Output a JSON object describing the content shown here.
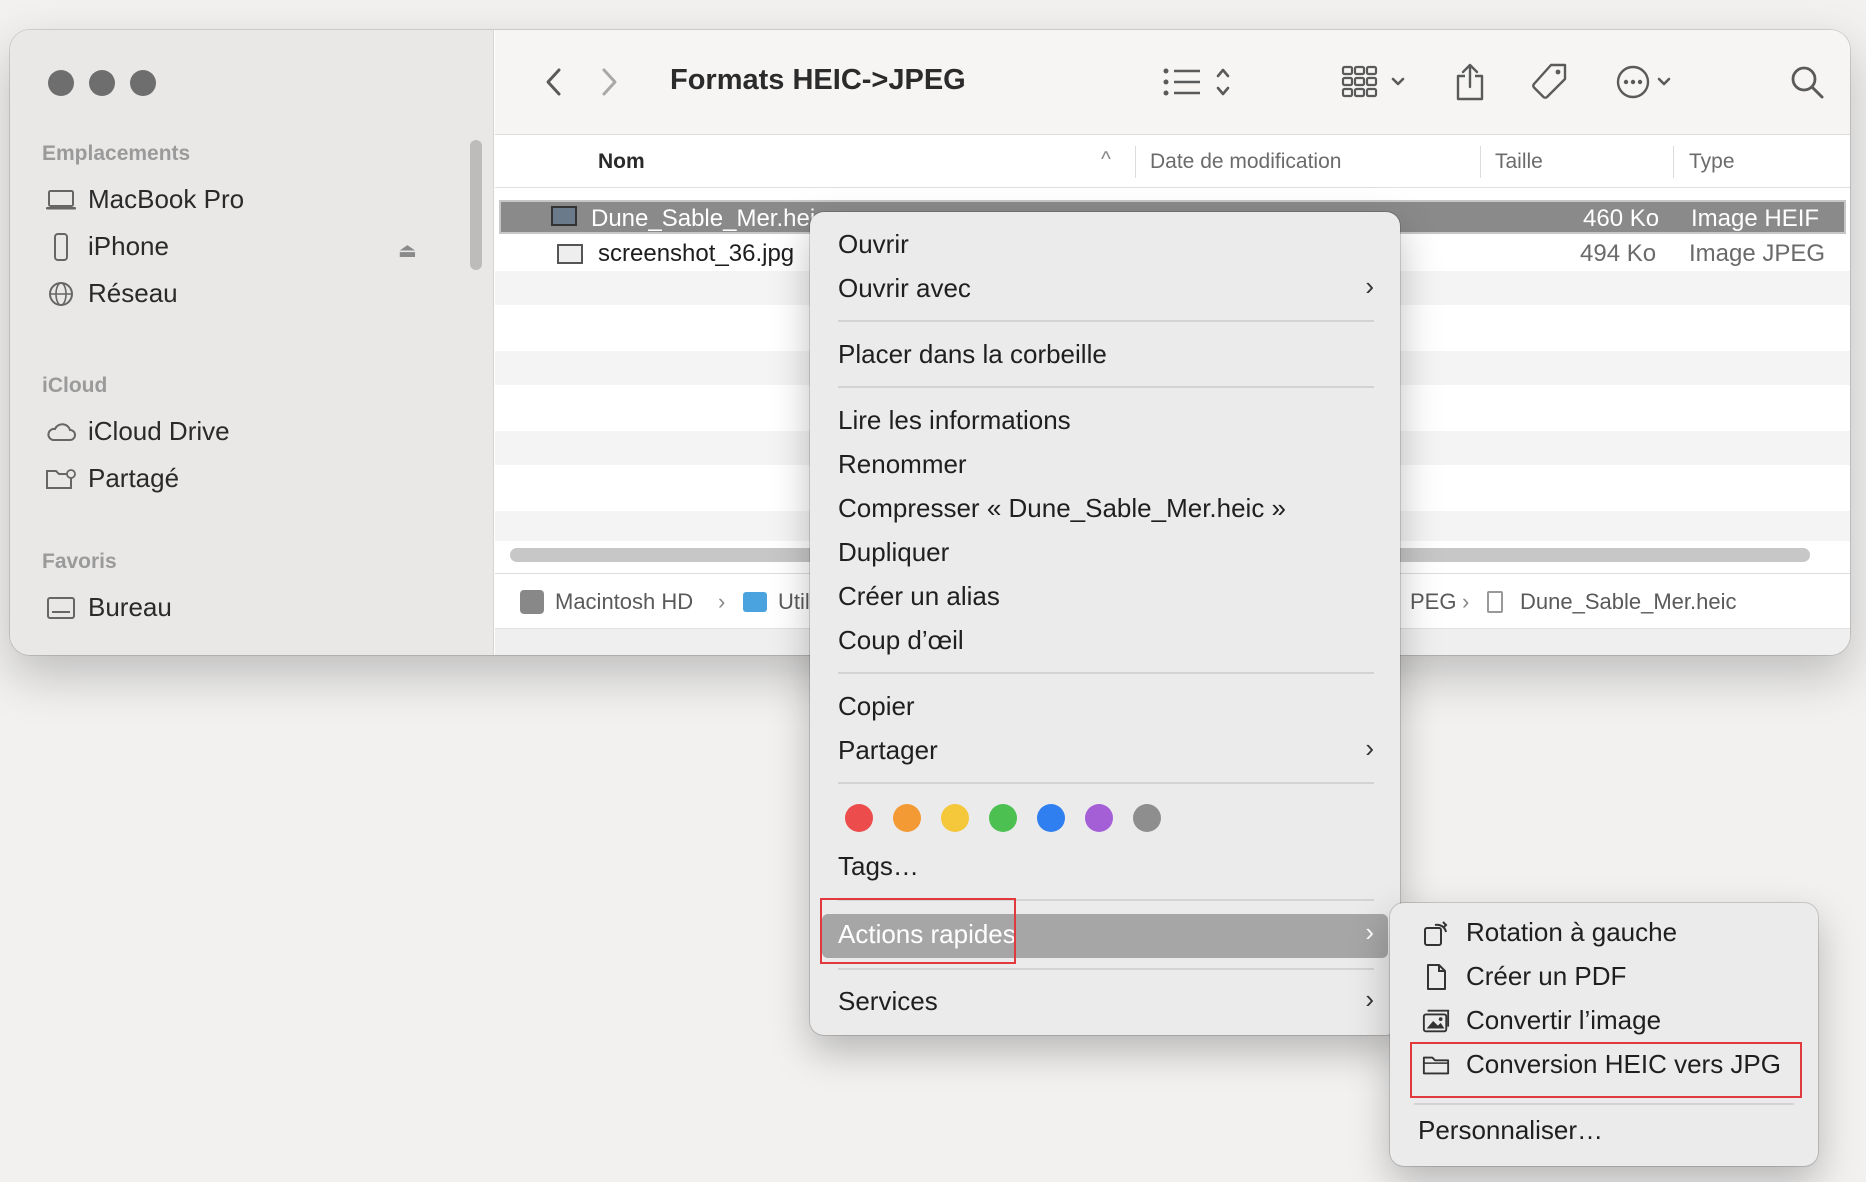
{
  "window": {
    "title": "Formats HEIC->JPEG"
  },
  "sidebar": {
    "sections": [
      {
        "header": "Emplacements",
        "items": [
          {
            "label": "MacBook Pro",
            "icon": "laptop-icon"
          },
          {
            "label": "iPhone",
            "icon": "iphone-icon",
            "eject": true
          },
          {
            "label": "Réseau",
            "icon": "globe-icon"
          }
        ]
      },
      {
        "header": "iCloud",
        "items": [
          {
            "label": "iCloud Drive",
            "icon": "cloud-icon"
          },
          {
            "label": "Partagé",
            "icon": "shared-folder-icon"
          }
        ]
      },
      {
        "header": "Favoris",
        "items": [
          {
            "label": "Bureau",
            "icon": "desktop-icon"
          }
        ]
      }
    ]
  },
  "columns": {
    "name": "Nom",
    "date": "Date de modification",
    "size": "Taille",
    "type": "Type"
  },
  "files": [
    {
      "name": "Dune_Sable_Mer.hei",
      "size": "460 Ko",
      "type": "Image HEIF",
      "selected": true
    },
    {
      "name": "screenshot_36.jpg",
      "size": "494 Ko",
      "type": "Image JPEG",
      "selected": false
    }
  ],
  "pathbar": {
    "items": [
      "Macintosh HD",
      "Utili",
      "PEG",
      "Dune_Sable_Mer.heic"
    ]
  },
  "context_menu": {
    "open": "Ouvrir",
    "open_with": "Ouvrir avec",
    "trash": "Placer dans la corbeille",
    "get_info": "Lire les informations",
    "rename": "Renommer",
    "compress": "Compresser « Dune_Sable_Mer.heic »",
    "duplicate": "Dupliquer",
    "alias": "Créer un alias",
    "quicklook": "Coup d’œil",
    "copy": "Copier",
    "share": "Partager",
    "tags": "Tags…",
    "quick_actions": "Actions rapides",
    "services": "Services",
    "tag_colors": [
      "#ec4c4b",
      "#f39a35",
      "#f5c73b",
      "#4cc152",
      "#2f7ff0",
      "#a45fd6",
      "#8e8e8e"
    ]
  },
  "submenu": {
    "rotate": "Rotation à gauche",
    "pdf": "Créer un PDF",
    "convert": "Convertir l’image",
    "heic_jpg": "Conversion HEIC vers JPG",
    "customize": "Personnaliser…"
  },
  "annotation_color": "#e0393e"
}
